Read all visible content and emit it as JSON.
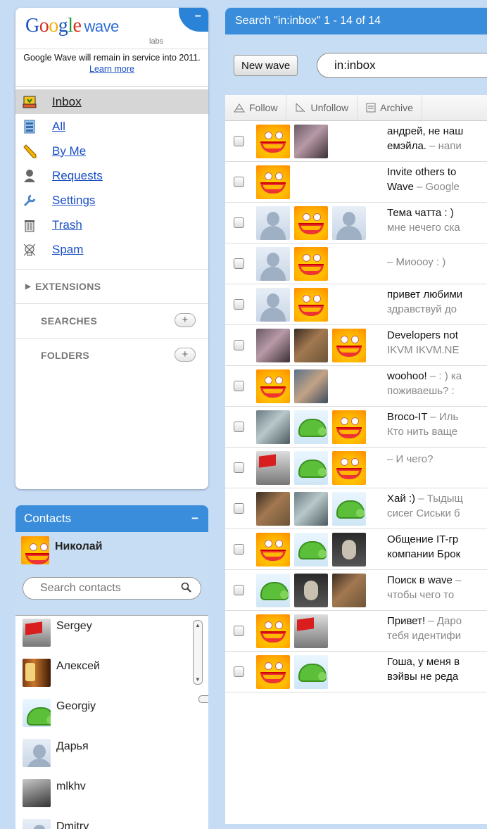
{
  "app": {
    "logo_google": "Google",
    "logo_wave": "wave",
    "logo_labs": "labs",
    "notice_text": "Google Wave will remain in service into 2011.",
    "notice_link": "Learn more",
    "minimize": "−"
  },
  "nav": {
    "items": [
      {
        "label": "Inbox",
        "icon": "inbox-icon"
      },
      {
        "label": "All",
        "icon": "all-icon"
      },
      {
        "label": "By Me",
        "icon": "pencil-icon"
      },
      {
        "label": "Requests",
        "icon": "person-icon"
      },
      {
        "label": "Settings",
        "icon": "wrench-icon"
      },
      {
        "label": "Trash",
        "icon": "trash-icon"
      },
      {
        "label": "Spam",
        "icon": "spam-icon"
      }
    ],
    "extensions": "EXTENSIONS",
    "searches": "SEARCHES",
    "folders": "FOLDERS",
    "plus": "+"
  },
  "contacts": {
    "title": "Contacts",
    "me": "Николай",
    "search_placeholder": "Search contacts",
    "list": [
      "Sergey",
      "Алексей",
      "Georgiy",
      "Дарья",
      "mlkhv",
      "Dmitry"
    ]
  },
  "main": {
    "title": "Search \"in:inbox\" 1 - 14 of 14",
    "new_wave": "New wave",
    "search_value": "in:inbox",
    "actions": [
      "Follow",
      "Unfollow",
      "Archive"
    ],
    "waves": [
      {
        "line1": "андрей, не наш",
        "line1_grey": "",
        "line2": "емэйла.",
        "line2_grey": " – напи"
      },
      {
        "line1": "Invite others to",
        "line1_grey": "",
        "line2": "Wave",
        "line2_grey": " – Google"
      },
      {
        "line1": "Тема чатта : )",
        "line1_grey": "",
        "line2": "",
        "line2_grey": "мне нечего ска"
      },
      {
        "line1": "",
        "line1_grey": "– Миоооу : )",
        "line2": "",
        "line2_grey": ""
      },
      {
        "line1": "привет любими",
        "line1_grey": "",
        "line2": "",
        "line2_grey": "здравствуй до"
      },
      {
        "line1": "Developers not",
        "line1_grey": "",
        "line2": "",
        "line2_grey": "IKVM IKVM.NE"
      },
      {
        "line1": "woohoo!",
        "line1_grey": " – : ) ка",
        "line2": "",
        "line2_grey": "поживаешь? :"
      },
      {
        "line1": "Broco-IT",
        "line1_grey": " – Иль",
        "line2": "",
        "line2_grey": "Кто нить ваще"
      },
      {
        "line1": "",
        "line1_grey": "– И чего?",
        "line2": "",
        "line2_grey": ""
      },
      {
        "line1": "Хай :)",
        "line1_grey": " – Тыдыщ",
        "line2": "",
        "line2_grey": "сисег Сиськи б"
      },
      {
        "line1": "Общение IT-гр",
        "line1_grey": "",
        "line2": "компании Брок",
        "line2_grey": ""
      },
      {
        "line1": "Поиск в wave",
        "line1_grey": " –",
        "line2": "",
        "line2_grey": "чтобы чего то"
      },
      {
        "line1": "Привет!",
        "line1_grey": " – Даро",
        "line2": "",
        "line2_grey": "тебя идентифи"
      },
      {
        "line1": "Гоша, у меня в",
        "line1_grey": "",
        "line2": "вэйвы не реда",
        "line2_grey": ""
      }
    ]
  }
}
